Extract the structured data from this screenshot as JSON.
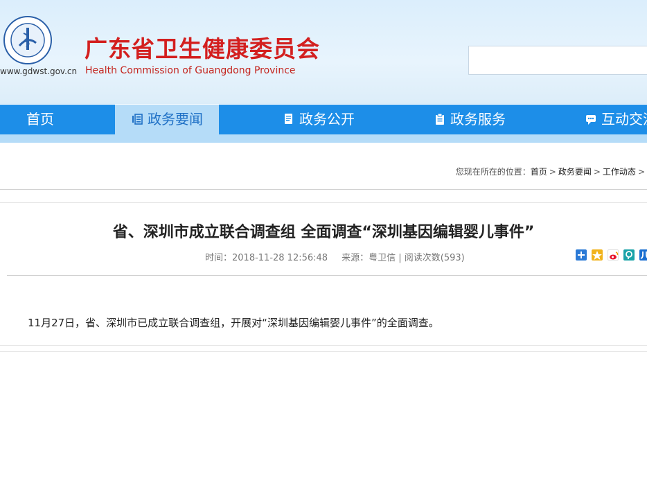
{
  "header": {
    "site_url": "www.gdwst.gov.cn",
    "title": "广东省卫生健康委员会",
    "subtitle": "Health Commission of Guangdong Province",
    "search_placeholder": ""
  },
  "nav": {
    "items": [
      {
        "label": "首页",
        "icon": "none"
      },
      {
        "label": "政务要闻",
        "icon": "news-icon",
        "active": true
      },
      {
        "label": "政务公开",
        "icon": "document-icon"
      },
      {
        "label": "政务服务",
        "icon": "clipboard-icon"
      },
      {
        "label": "互动交流",
        "icon": "chat-icon"
      }
    ]
  },
  "breadcrumb": {
    "prefix": "您现在所在的位置：",
    "items": [
      "首页",
      "政务要闻",
      "工作动态"
    ]
  },
  "article": {
    "title": "省、深圳市成立联合调查组 全面调查“深圳基因编辑婴儿事件”",
    "time": "时间：2018-11-28 12:56:48",
    "source": "来源：粤卫信",
    "views": "阅读次数(593)",
    "body": "11月27日，省、深圳市已成立联合调查组，开展对“深圳基因编辑婴儿事件”的全面调查。"
  },
  "share_icons": [
    "plus-share-icon",
    "qzone-icon",
    "weibo-icon",
    "pinterest-icon",
    "renren-icon"
  ],
  "colors": {
    "nav_bg": "#1d8ee8",
    "nav_active_bg": "#b5dcf8",
    "title_red": "#d31f1f"
  }
}
